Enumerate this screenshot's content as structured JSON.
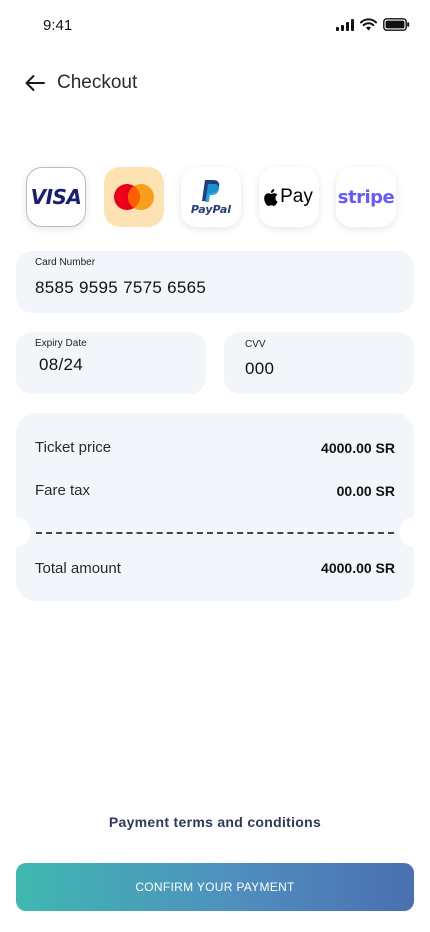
{
  "status_bar": {
    "time": "9:41"
  },
  "header": {
    "title": "Checkout"
  },
  "payment_methods": {
    "visa_label": "VISA",
    "paypal_label": "PayPal",
    "applepay_label": "Pay",
    "stripe_label": "stripe",
    "selected": "mastercard"
  },
  "card": {
    "number_label": "Card Number",
    "number_value": "8585 9595 7575 6565",
    "expiry_label": "Expiry Date",
    "expiry_value": "08/24",
    "cvv_label": "CVV",
    "cvv_value": "000"
  },
  "summary": {
    "ticket_label": "Ticket price",
    "ticket_value": "4000.00 SR",
    "tax_label": "Fare tax",
    "tax_value": "00.00 SR",
    "total_label": "Total amount",
    "total_value": "4000.00 SR"
  },
  "footer": {
    "terms_link": "Payment terms and conditions",
    "confirm_button": "CONFIRM YOUR PAYMENT"
  },
  "colors": {
    "field_bg": "#f2f5fa",
    "gradient_start": "#3fb8b0",
    "gradient_end": "#4a6fb0",
    "mastercard_selected_bg": "#fde2b3"
  }
}
